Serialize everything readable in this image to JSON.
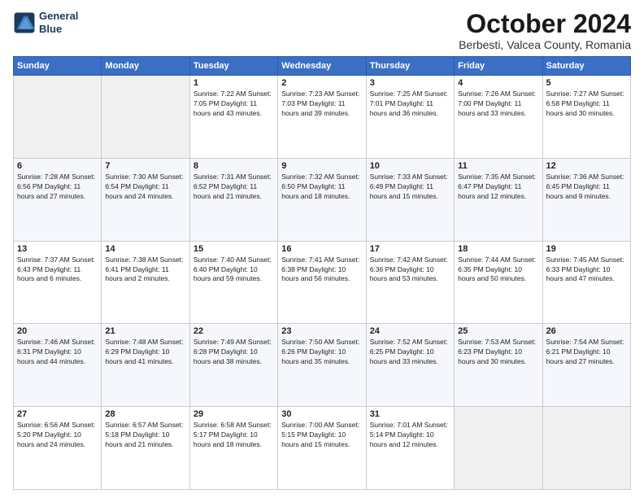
{
  "header": {
    "logo_line1": "General",
    "logo_line2": "Blue",
    "title": "October 2024",
    "subtitle": "Berbesti, Valcea County, Romania"
  },
  "weekdays": [
    "Sunday",
    "Monday",
    "Tuesday",
    "Wednesday",
    "Thursday",
    "Friday",
    "Saturday"
  ],
  "weeks": [
    [
      {
        "day": "",
        "info": ""
      },
      {
        "day": "",
        "info": ""
      },
      {
        "day": "1",
        "info": "Sunrise: 7:22 AM\nSunset: 7:05 PM\nDaylight: 11 hours and 43 minutes."
      },
      {
        "day": "2",
        "info": "Sunrise: 7:23 AM\nSunset: 7:03 PM\nDaylight: 11 hours and 39 minutes."
      },
      {
        "day": "3",
        "info": "Sunrise: 7:25 AM\nSunset: 7:01 PM\nDaylight: 11 hours and 36 minutes."
      },
      {
        "day": "4",
        "info": "Sunrise: 7:26 AM\nSunset: 7:00 PM\nDaylight: 11 hours and 33 minutes."
      },
      {
        "day": "5",
        "info": "Sunrise: 7:27 AM\nSunset: 6:58 PM\nDaylight: 11 hours and 30 minutes."
      }
    ],
    [
      {
        "day": "6",
        "info": "Sunrise: 7:28 AM\nSunset: 6:56 PM\nDaylight: 11 hours and 27 minutes."
      },
      {
        "day": "7",
        "info": "Sunrise: 7:30 AM\nSunset: 6:54 PM\nDaylight: 11 hours and 24 minutes."
      },
      {
        "day": "8",
        "info": "Sunrise: 7:31 AM\nSunset: 6:52 PM\nDaylight: 11 hours and 21 minutes."
      },
      {
        "day": "9",
        "info": "Sunrise: 7:32 AM\nSunset: 6:50 PM\nDaylight: 11 hours and 18 minutes."
      },
      {
        "day": "10",
        "info": "Sunrise: 7:33 AM\nSunset: 6:49 PM\nDaylight: 11 hours and 15 minutes."
      },
      {
        "day": "11",
        "info": "Sunrise: 7:35 AM\nSunset: 6:47 PM\nDaylight: 11 hours and 12 minutes."
      },
      {
        "day": "12",
        "info": "Sunrise: 7:36 AM\nSunset: 6:45 PM\nDaylight: 11 hours and 9 minutes."
      }
    ],
    [
      {
        "day": "13",
        "info": "Sunrise: 7:37 AM\nSunset: 6:43 PM\nDaylight: 11 hours and 6 minutes."
      },
      {
        "day": "14",
        "info": "Sunrise: 7:38 AM\nSunset: 6:41 PM\nDaylight: 11 hours and 2 minutes."
      },
      {
        "day": "15",
        "info": "Sunrise: 7:40 AM\nSunset: 6:40 PM\nDaylight: 10 hours and 59 minutes."
      },
      {
        "day": "16",
        "info": "Sunrise: 7:41 AM\nSunset: 6:38 PM\nDaylight: 10 hours and 56 minutes."
      },
      {
        "day": "17",
        "info": "Sunrise: 7:42 AM\nSunset: 6:36 PM\nDaylight: 10 hours and 53 minutes."
      },
      {
        "day": "18",
        "info": "Sunrise: 7:44 AM\nSunset: 6:35 PM\nDaylight: 10 hours and 50 minutes."
      },
      {
        "day": "19",
        "info": "Sunrise: 7:45 AM\nSunset: 6:33 PM\nDaylight: 10 hours and 47 minutes."
      }
    ],
    [
      {
        "day": "20",
        "info": "Sunrise: 7:46 AM\nSunset: 6:31 PM\nDaylight: 10 hours and 44 minutes."
      },
      {
        "day": "21",
        "info": "Sunrise: 7:48 AM\nSunset: 6:29 PM\nDaylight: 10 hours and 41 minutes."
      },
      {
        "day": "22",
        "info": "Sunrise: 7:49 AM\nSunset: 6:28 PM\nDaylight: 10 hours and 38 minutes."
      },
      {
        "day": "23",
        "info": "Sunrise: 7:50 AM\nSunset: 6:26 PM\nDaylight: 10 hours and 35 minutes."
      },
      {
        "day": "24",
        "info": "Sunrise: 7:52 AM\nSunset: 6:25 PM\nDaylight: 10 hours and 33 minutes."
      },
      {
        "day": "25",
        "info": "Sunrise: 7:53 AM\nSunset: 6:23 PM\nDaylight: 10 hours and 30 minutes."
      },
      {
        "day": "26",
        "info": "Sunrise: 7:54 AM\nSunset: 6:21 PM\nDaylight: 10 hours and 27 minutes."
      }
    ],
    [
      {
        "day": "27",
        "info": "Sunrise: 6:56 AM\nSunset: 5:20 PM\nDaylight: 10 hours and 24 minutes."
      },
      {
        "day": "28",
        "info": "Sunrise: 6:57 AM\nSunset: 5:18 PM\nDaylight: 10 hours and 21 minutes."
      },
      {
        "day": "29",
        "info": "Sunrise: 6:58 AM\nSunset: 5:17 PM\nDaylight: 10 hours and 18 minutes."
      },
      {
        "day": "30",
        "info": "Sunrise: 7:00 AM\nSunset: 5:15 PM\nDaylight: 10 hours and 15 minutes."
      },
      {
        "day": "31",
        "info": "Sunrise: 7:01 AM\nSunset: 5:14 PM\nDaylight: 10 hours and 12 minutes."
      },
      {
        "day": "",
        "info": ""
      },
      {
        "day": "",
        "info": ""
      }
    ]
  ]
}
